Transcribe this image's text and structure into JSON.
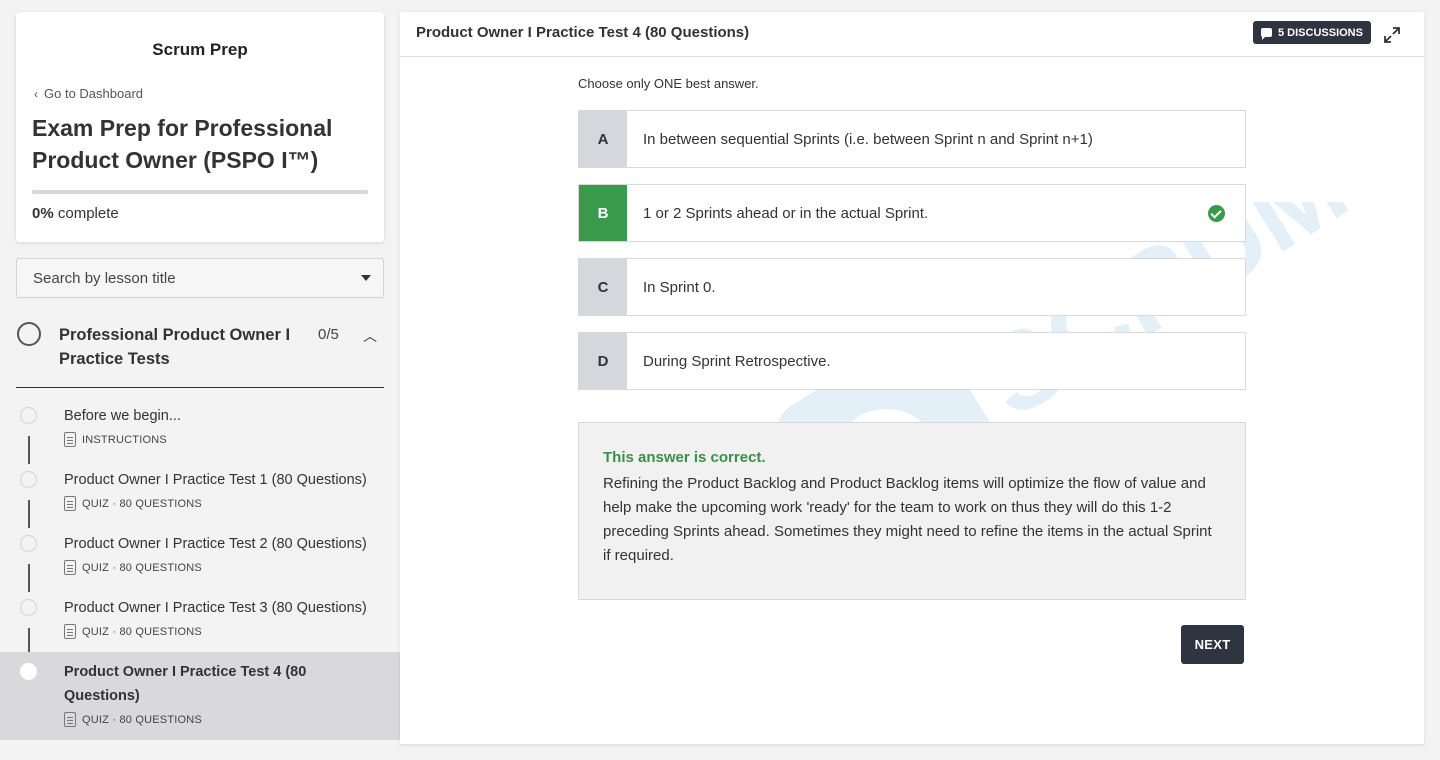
{
  "sidebar": {
    "school_name": "Scrum Prep",
    "back_link": "Go to Dashboard",
    "course_title": "Exam Prep for Professional Product Owner (PSPO I™)",
    "progress_percent": "0%",
    "progress_label": "complete",
    "progress_fraction": 0,
    "search_placeholder": "Search by lesson title",
    "chapter": {
      "title": "Professional Product Owner I Practice Tests",
      "count": "0/5"
    },
    "lessons": [
      {
        "title": "Before we begin...",
        "meta": "INSTRUCTIONS"
      },
      {
        "title": "Product Owner I Practice Test 1 (80 Questions)",
        "meta": "QUIZ · 80 QUESTIONS"
      },
      {
        "title": "Product Owner I Practice Test 2 (80 Questions)",
        "meta": "QUIZ · 80 QUESTIONS"
      },
      {
        "title": "Product Owner I Practice Test 3 (80 Questions)",
        "meta": "QUIZ · 80 QUESTIONS"
      },
      {
        "title": "Product Owner I Practice Test 4 (80 Questions)",
        "meta": "QUIZ · 80 QUESTIONS"
      }
    ]
  },
  "main": {
    "title": "Product Owner I Practice Test 4 (80 Questions)",
    "discussions_label": "5 DISCUSSIONS",
    "instruction": "Choose only ONE best answer.",
    "options": [
      {
        "letter": "A",
        "text": "In between sequential Sprints (i.e. between Sprint n and Sprint n+1)"
      },
      {
        "letter": "B",
        "text": "1 or 2 Sprints ahead or in the actual Sprint."
      },
      {
        "letter": "C",
        "text": "In Sprint 0."
      },
      {
        "letter": "D",
        "text": "During Sprint Retrospective."
      }
    ],
    "feedback_title": "This answer is correct.",
    "feedback_body": "Refining the Product Backlog and Product Backlog items will optimize the flow of value and help make the upcoming work 'ready' for the team to work on thus they will do this 1-2 preceding Sprints ahead. Sometimes they might need to refine the items in the actual Sprint if required.",
    "next_label": "NEXT",
    "watermark_text": "SCRUMPREP"
  },
  "colors": {
    "accent_dark": "#2e3440",
    "correct_green": "#3a9a4c",
    "watermark": "#cfe4f4"
  }
}
